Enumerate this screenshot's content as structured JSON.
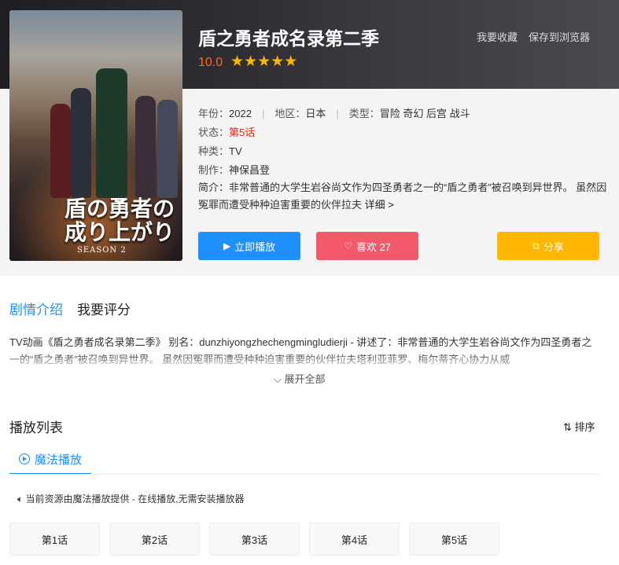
{
  "header": {
    "title": "盾之勇者成名录第二季",
    "score": "10.0",
    "stars": "★★★★★",
    "fav_label": "我要收藏",
    "save_label": "保存到浏览器"
  },
  "poster": {
    "title_line1": "盾の勇者の",
    "title_line2": "成り上がり",
    "subtitle": "SEASON 2"
  },
  "info": {
    "year_label": "年份：",
    "year": "2022",
    "region_label": "地区：",
    "region": "日本",
    "genre_label": "类型：",
    "genres": "冒险 奇幻 后宫 战斗",
    "status_label": "状态：",
    "status": "第5话",
    "kind_label": "种类：",
    "kind": "TV",
    "studio_label": "制作：",
    "studio": "神保昌登",
    "synopsis_label": "简介：",
    "synopsis": "非常普通的大学生岩谷尚文作为四圣勇者之一的“盾之勇者”被召唤到异世界。 虽然因冤罪而遭受种种迫害重要的伙伴拉夫",
    "more_label": "详细 >"
  },
  "actions": {
    "play": "立即播放",
    "like": "喜欢 27",
    "share": "分享"
  },
  "tabs": {
    "intro": "剧情介绍",
    "review": "我要评分"
  },
  "intro_text": "TV动画《盾之勇者成名录第二季》 别名：dunzhiyongzhechengmingludierji - 讲述了：非常普通的大学生岩谷尚文作为四圣勇者之一的“盾之勇者”被召唤到异世界。 虽然因冤罪而遭受种种迫害重要的伙伴拉夫塔利亚菲罗、梅尔蒂齐心协力从威",
  "expand_label": "展开全部",
  "playlist": {
    "title": "播放列表",
    "sort_label": "排序",
    "source_tab": "魔法播放",
    "notice": "当前资源由魔法播放提供 - 在线播放,无需安装播放器",
    "episodes": [
      "第1话",
      "第2话",
      "第3话",
      "第4话",
      "第5话"
    ]
  }
}
